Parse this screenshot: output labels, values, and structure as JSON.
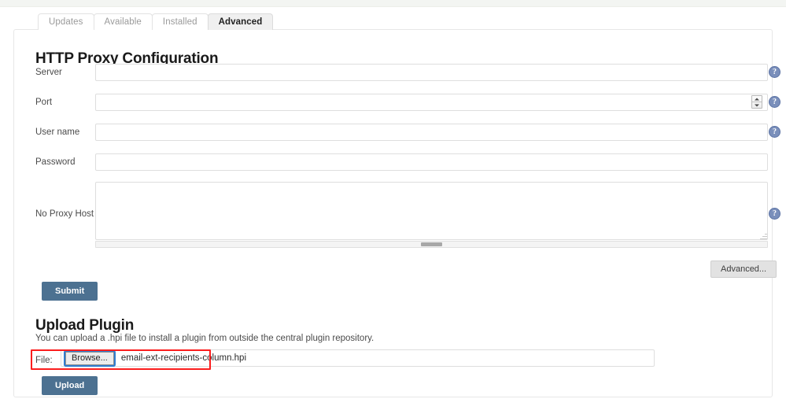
{
  "tabs": [
    {
      "label": "Updates",
      "active": false
    },
    {
      "label": "Available",
      "active": false
    },
    {
      "label": "Installed",
      "active": false
    },
    {
      "label": "Advanced",
      "active": true
    }
  ],
  "proxy_section": {
    "heading": "HTTP Proxy Configuration",
    "fields": [
      {
        "label": "Server",
        "value": "",
        "help": "?"
      },
      {
        "label": "Port",
        "value": "",
        "help": "?"
      },
      {
        "label": "User name",
        "value": "",
        "help": "?"
      },
      {
        "label": "Password",
        "value": "",
        "help": ""
      },
      {
        "label": "No Proxy Host",
        "value": "",
        "help": "?"
      }
    ],
    "advanced_button": "Advanced...",
    "submit_button": "Submit"
  },
  "upload_section": {
    "heading": "Upload Plugin",
    "description": "You can upload a .hpi file to install a plugin from outside the central plugin repository.",
    "file_label": "File:",
    "browse_button": "Browse...",
    "file_name": "email-ext-recipients-column.hpi",
    "upload_button": "Upload"
  },
  "colors": {
    "accent_blue": "#4c7191",
    "help_icon": "#7a8fbb",
    "highlight_red": "#fb1d1d",
    "focus_ring": "#2f7dd1",
    "active_tab_bg": "#f0f0f0"
  }
}
